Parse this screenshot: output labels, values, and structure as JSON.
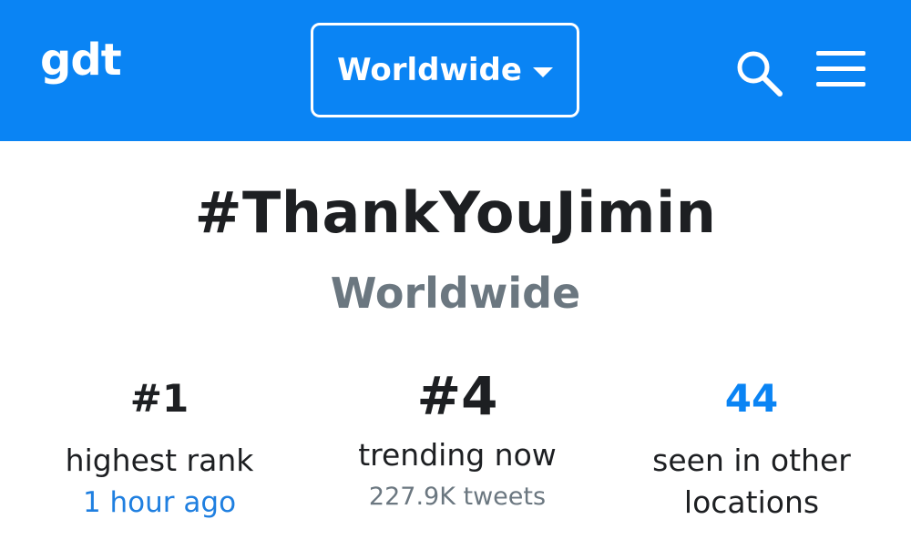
{
  "header": {
    "logo": "gdt",
    "region_select": "Worldwide",
    "search_icon": "search-icon",
    "menu_icon": "hamburger-menu-icon",
    "bar_color": "#0a84f4"
  },
  "trend": {
    "hashtag": "#ThankYouJimin",
    "location": "Worldwide"
  },
  "stats": {
    "highest": {
      "value": "#1",
      "label": "highest rank",
      "sub": "1 hour ago"
    },
    "now": {
      "value": "#4",
      "label": "trending now",
      "sub": "227.9K tweets"
    },
    "other": {
      "value": "44",
      "label_line1": "seen in other",
      "label_line2": "locations"
    }
  }
}
